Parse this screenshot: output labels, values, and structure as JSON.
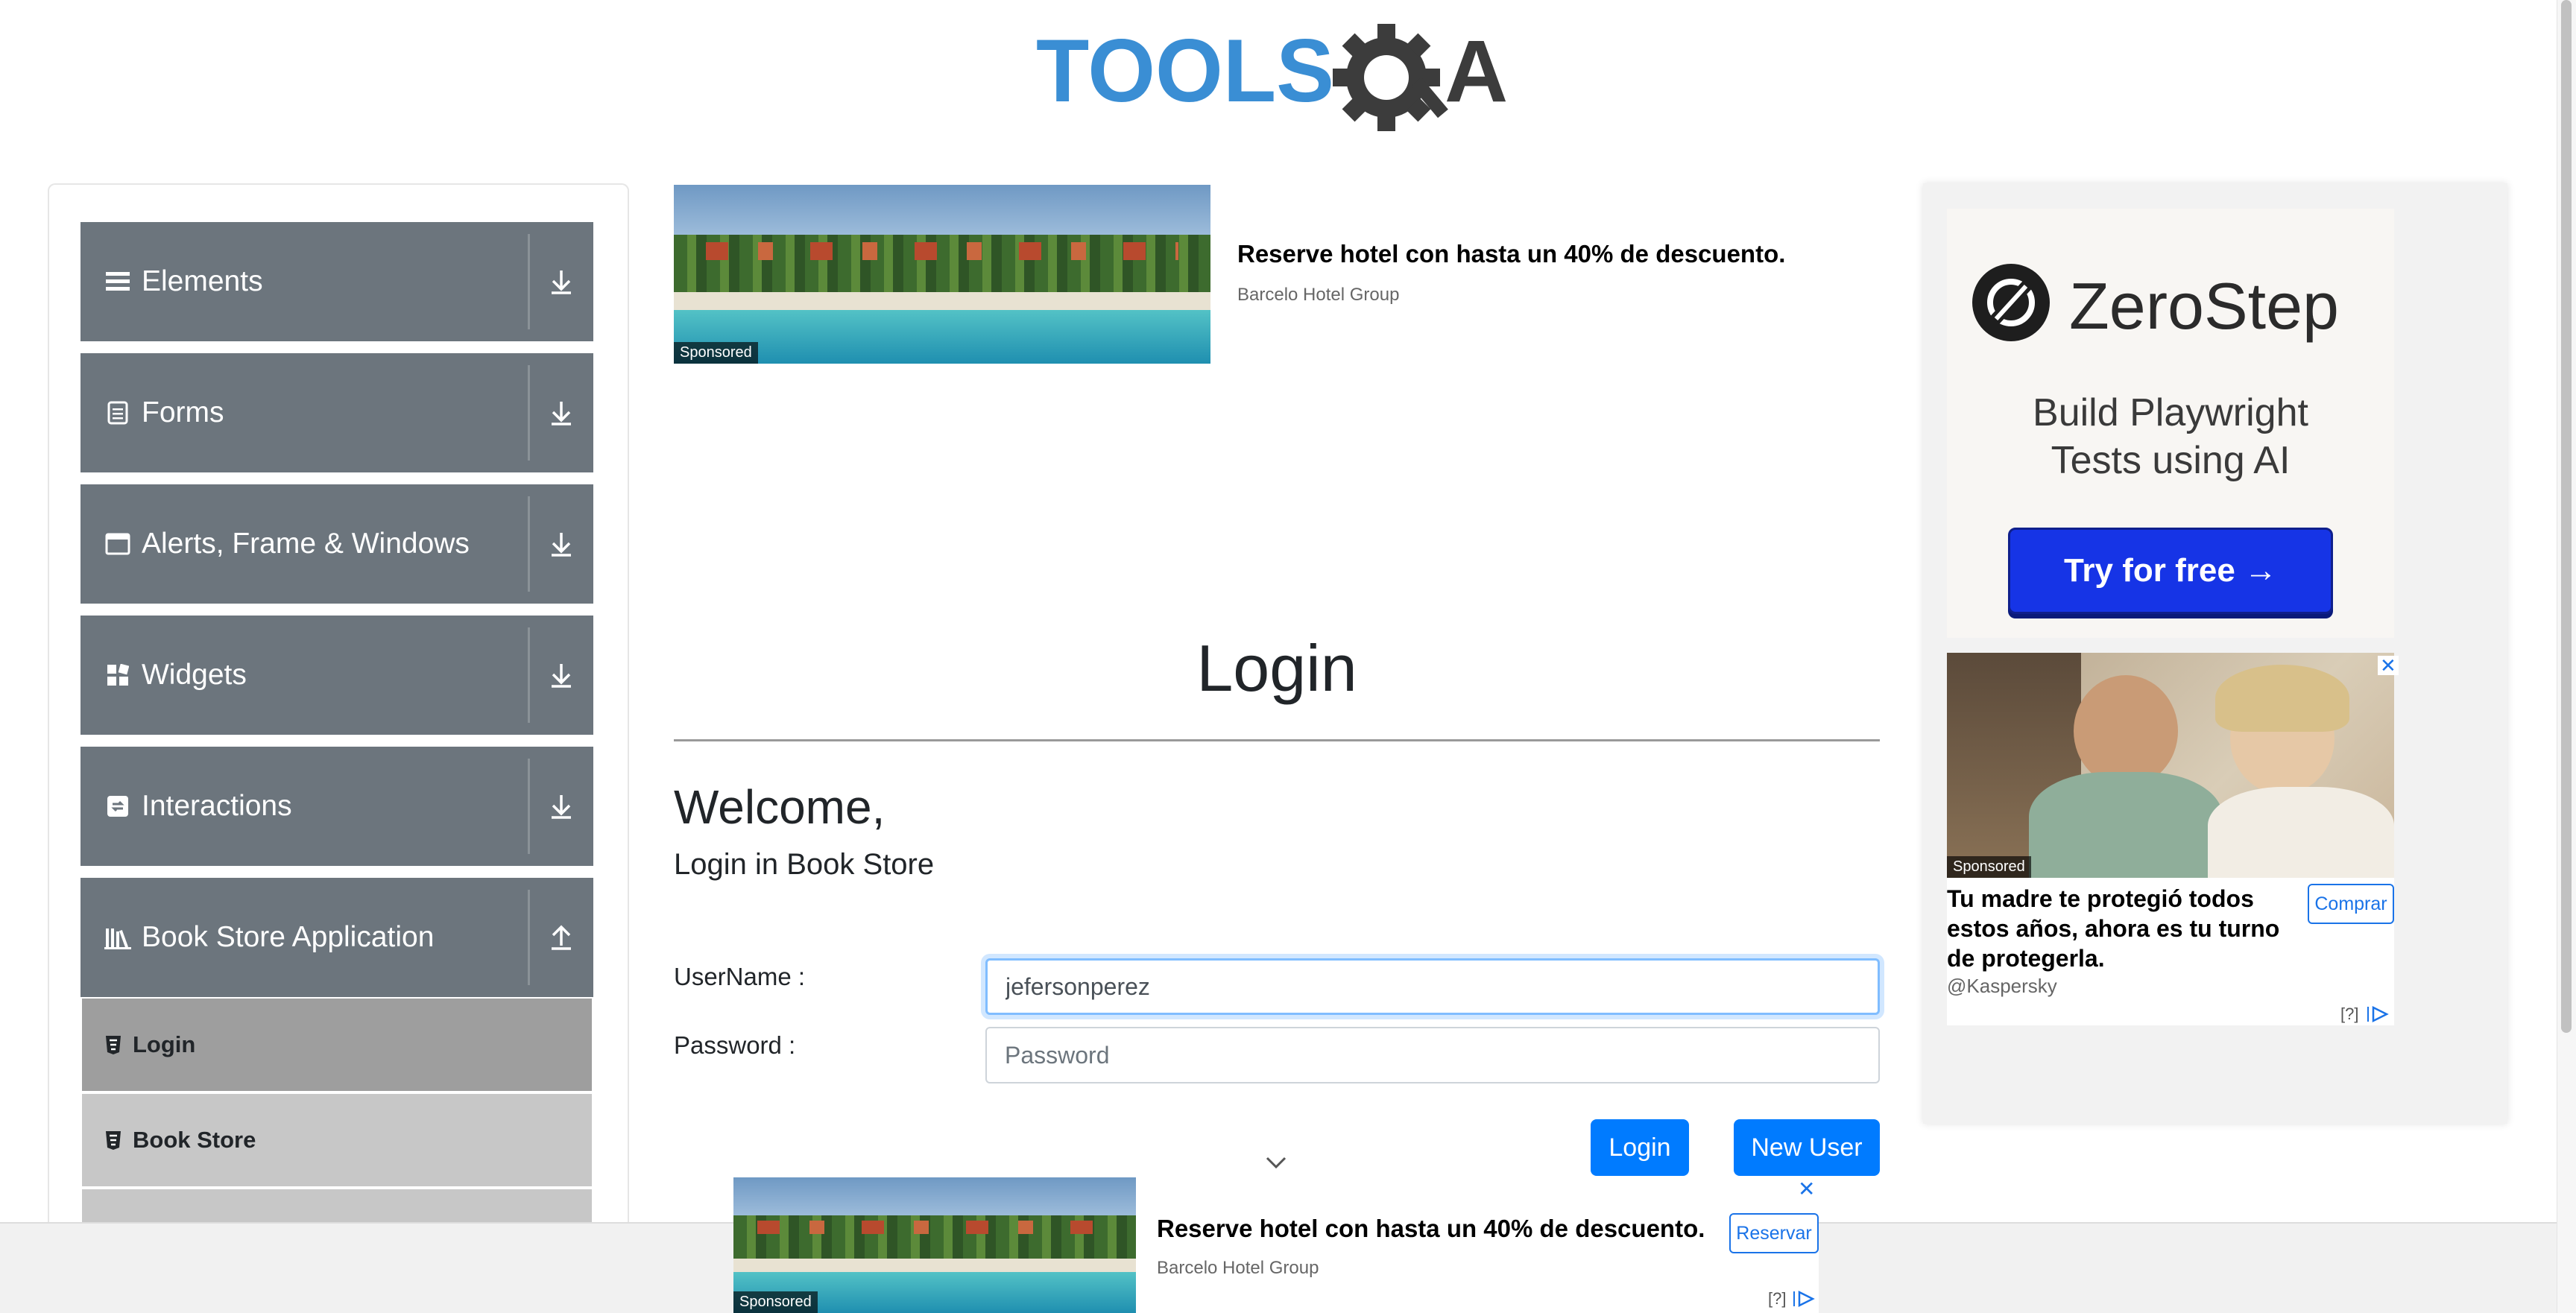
{
  "logo": {
    "text_left": "TOOLS",
    "text_right": "QA"
  },
  "sidebar": {
    "groups": [
      {
        "label": "Elements",
        "icon": "hamburger-icon",
        "arrow": "down"
      },
      {
        "label": "Forms",
        "icon": "document-icon",
        "arrow": "down"
      },
      {
        "label": "Alerts, Frame & Windows",
        "icon": "window-icon",
        "arrow": "down"
      },
      {
        "label": "Widgets",
        "icon": "widgets-icon",
        "arrow": "down"
      },
      {
        "label": "Interactions",
        "icon": "interactions-icon",
        "arrow": "down"
      },
      {
        "label": "Book Store Application",
        "icon": "books-icon",
        "arrow": "up"
      }
    ],
    "subitems": [
      {
        "label": "Login",
        "active": true
      },
      {
        "label": "Book Store",
        "active": false
      }
    ]
  },
  "top_ad": {
    "headline": "Reserve hotel con hasta un 40% de descuento.",
    "source": "Barcelo Hotel Group",
    "sponsored": "Sponsored"
  },
  "login": {
    "title": "Login",
    "welcome": "Welcome,",
    "subtitle": "Login in Book Store",
    "username_label": "UserName :",
    "username_value": "jefersonperez",
    "password_label": "Password :",
    "password_placeholder": "Password",
    "login_button": "Login",
    "new_user_button": "New User"
  },
  "right_ad": {
    "brand": "ZeroStep",
    "tagline_1": "Build Playwright",
    "tagline_2": "Tests using AI",
    "cta": "Try for free →",
    "kaspersky": {
      "sponsored": "Sponsored",
      "headline": "Tu madre te protegió todos estos años, ahora es tu turno de protegerla.",
      "source": "@Kaspersky",
      "button": "Comprar",
      "adchoice": "[?]"
    }
  },
  "bottom_ad": {
    "headline": "Reserve hotel con hasta un 40% de descuento.",
    "source": "Barcelo Hotel Group",
    "sponsored": "Sponsored",
    "button": "Reservar",
    "adchoice": "[?]"
  },
  "colors": {
    "sidebar_group": "#6c757d",
    "sidebar_sub": "#c7c7c7",
    "sidebar_sub_active": "#9e9e9e",
    "primary": "#007bff",
    "logo_blue": "#3a8ed4",
    "logo_dark": "#3c3c3c"
  }
}
